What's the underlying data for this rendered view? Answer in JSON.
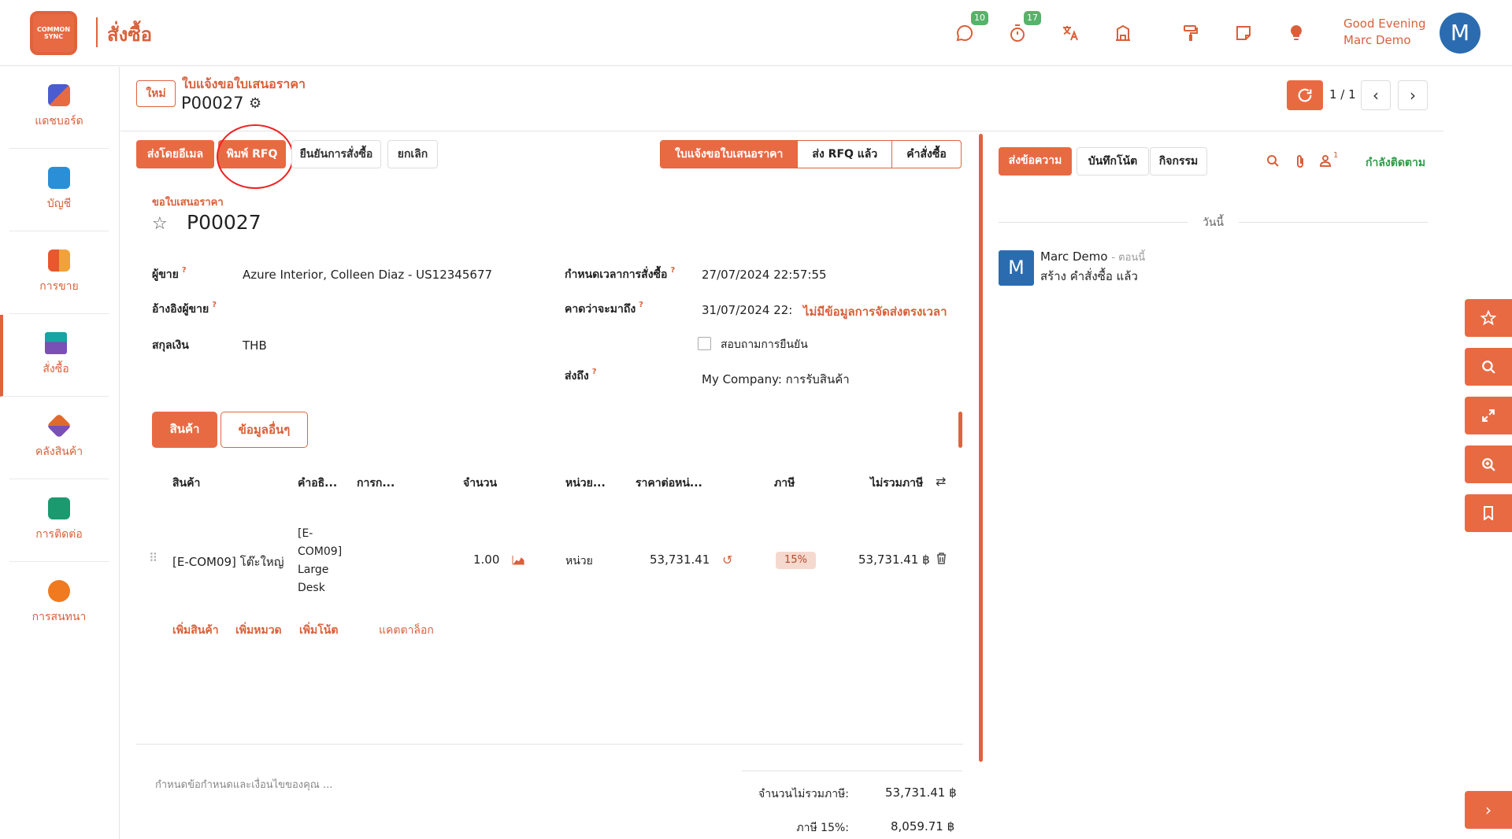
{
  "app": {
    "logo_text": "COMMON SYNC",
    "title": "สั่งซื้อ"
  },
  "topbar": {
    "messages_badge": "10",
    "activities_badge": "17",
    "greeting_line1": "Good Evening",
    "greeting_line2": "Marc Demo",
    "avatar_letter": "M"
  },
  "sidebar": {
    "items": [
      {
        "label": "แดชบอร์ด",
        "color": "#4a5ccf"
      },
      {
        "label": "บัญชี",
        "color": "#2a8fd6"
      },
      {
        "label": "การขาย",
        "color": "#e8572e"
      },
      {
        "label": "สั่งซื้อ",
        "color": "#1aa3a3"
      },
      {
        "label": "คลังสินค้า",
        "color": "#e06a2c"
      },
      {
        "label": "การติดต่อ",
        "color": "#1b9a6f"
      },
      {
        "label": "การสนทนา",
        "color": "#f07a1f"
      }
    ]
  },
  "header": {
    "new_label": "ใหม่",
    "breadcrumb": "ใบแจ้งขอใบเสนอราคา",
    "record_id": "P00027",
    "pager": "1 / 1"
  },
  "actions": {
    "send_email": "ส่งโดยอีเมล",
    "print_rfq": "พิมพ์ RFQ",
    "confirm_order": "ยืนยันการสั่งซื้อ",
    "cancel": "ยกเลิก"
  },
  "status": {
    "stages": [
      "ใบแจ้งขอใบเสนอราคา",
      "ส่ง RFQ แล้ว",
      "คำสั่งซื้อ"
    ]
  },
  "form": {
    "subtitle": "ขอใบเสนอราคา",
    "name": "P00027",
    "vendor_label": "ผู้ขาย",
    "vendor_value": "Azure Interior, Colleen Diaz - US12345677",
    "vendor_ref_label": "อ้างอิงผู้ขาย",
    "currency_label": "สกุลเงิน",
    "currency_value": "THB",
    "order_deadline_label": "กำหนดเวลาการสั่งซื้อ",
    "order_deadline_value": "27/07/2024 22:57:55",
    "expected_label": "คาดว่าจะมาถึง",
    "expected_value": "31/07/2024 22:",
    "expected_warning": "ไม่มีข้อมูลการจัดส่งตรงเวลา",
    "ask_confirm_label": "สอบถามการยืนยัน",
    "deliver_to_label": "ส่งถึง",
    "deliver_to_value": "My Company: การรับสินค้า"
  },
  "tabs": {
    "products": "สินค้า",
    "other_info": "ข้อมูลอื่นๆ"
  },
  "table": {
    "headers": [
      "สินค้า",
      "คำอธิ...",
      "การก...",
      "จำนวน",
      "หน่วย...",
      "ราคาต่อหน่...",
      "ภาษี",
      "ไม่รวมภาษี"
    ],
    "rows": [
      {
        "product": "[E-COM09] โต๊ะใหญ่",
        "description_lines": [
          "[E-",
          "COM09]",
          "Large",
          "Desk"
        ],
        "quantity": "1.00",
        "unit": "หน่วย",
        "price": "53,731.41",
        "tax": "15%",
        "subtotal": "53,731.41 ฿"
      }
    ],
    "add_product": "เพิ่มสินค้า",
    "add_section": "เพิ่มหมวด",
    "add_note": "เพิ่มโน้ต",
    "catalog": "แคตตาล็อก"
  },
  "footer": {
    "terms_placeholder": "กำหนดข้อกำหนดและเงื่อนไขของคุณ ...",
    "untaxed_label": "จำนวนไม่รวมภาษี:",
    "untaxed_value": "53,731.41 ฿",
    "tax_label": "ภาษี 15%:",
    "tax_value": "8,059.71 ฿"
  },
  "chatter": {
    "send_message": "ส่งข้อความ",
    "log_note": "บันทึกโน้ต",
    "activities": "กิจกรรม",
    "followers_count": "1",
    "following": "กำลังติดตาม",
    "today": "วันนี้",
    "message": {
      "avatar": "M",
      "author": "Marc Demo",
      "time": "- ตอนนี้",
      "body": "สร้าง คำสั่งซื้อ แล้ว"
    }
  }
}
